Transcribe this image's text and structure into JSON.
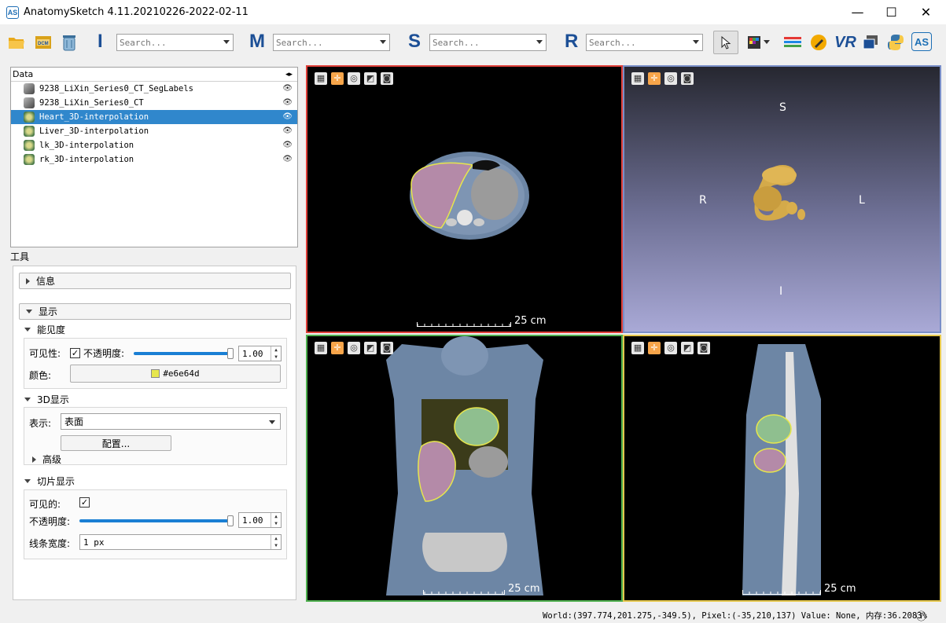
{
  "window": {
    "title": "AnatomySketch 4.11.20210226-2022-02-11",
    "app_icon_text": "AS",
    "minimize_glyph": "—",
    "maximize_glyph": "☐",
    "close_glyph": "✕"
  },
  "toolbar": {
    "letters": [
      "I",
      "M",
      "S",
      "R"
    ],
    "search_placeholder": "Search...",
    "vr_label": "VR",
    "as_label": "AS",
    "icons": [
      "open-folder-icon",
      "dicom-icon",
      "trash-icon",
      "pointer-icon",
      "color-map-icon",
      "layers-icon",
      "pencil-icon",
      "vr-icon",
      "window-icon",
      "python-icon",
      "as-icon"
    ]
  },
  "data_panel": {
    "header": "Data",
    "items": [
      {
        "name": "9238_LiXin_Series0_CT_SegLabels",
        "type": "volume",
        "selected": false
      },
      {
        "name": "9238_LiXin_Series0_CT",
        "type": "volume",
        "selected": false
      },
      {
        "name": "Heart_3D-interpolation",
        "type": "segmentation",
        "selected": true
      },
      {
        "name": "Liver_3D-interpolation",
        "type": "segmentation",
        "selected": false
      },
      {
        "name": "lk_3D-interpolation",
        "type": "segmentation",
        "selected": false
      },
      {
        "name": "rk_3D-interpolation",
        "type": "segmentation",
        "selected": false
      }
    ],
    "eye_glyph": "👁"
  },
  "tools": {
    "label": "工具",
    "info_section": "信息",
    "display_section": "显示",
    "visibility_group": "能见度",
    "visibility_label": "可见性:",
    "visibility_checked": "✓",
    "opacity_label": "不透明度:",
    "opacity_value": "1.00",
    "color_label": "颜色:",
    "color_value": "#e6e64d",
    "color_hex": "#e6e64d",
    "display3d_group": "3D显示",
    "representation_label": "表示:",
    "representation_value": "表面",
    "configure_button": "配置...",
    "advanced_label": "高级",
    "slice_group": "切片显示",
    "slice_visible_label": "可见的:",
    "slice_visible_checked": "✓",
    "slice_opacity_label": "不透明度:",
    "slice_opacity_value": "1.00",
    "line_width_label": "线条宽度:",
    "line_width_value": "1 px"
  },
  "viewports": {
    "scale_label": "25 cm",
    "orientation_3d": {
      "top": "S",
      "bottom": "I",
      "left": "R",
      "right": "L"
    },
    "border_colors": {
      "axial": "#e0403a",
      "volume3d": "#7a8fc8",
      "coronal": "#4fb14f",
      "sagittal": "#e6c84d"
    }
  },
  "status": {
    "text": "World:(397.774,201.275,-349.5), Pixel:(-35,210,137) Value: None, 内存:36.2083%",
    "info_glyph": "ⓘ"
  }
}
